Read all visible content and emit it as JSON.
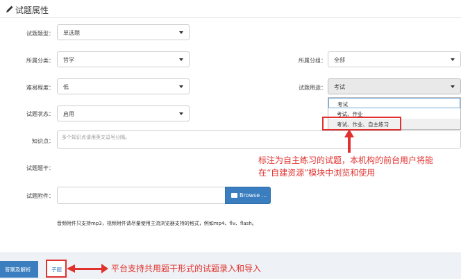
{
  "header": {
    "title": "试题属性",
    "icon": "pencil-icon"
  },
  "form": {
    "type_label": "试题题型：",
    "type_value": "单选题",
    "category_label": "所属分类：",
    "category_value": "哲学",
    "group_label": "所属分组：",
    "group_value": "全部",
    "difficulty_label": "难易程度：",
    "difficulty_value": "低",
    "usage_label": "试题用途：",
    "usage_value": "考试",
    "usage_options": [
      "考试",
      "考试、作业",
      "考试、作业、自主练习"
    ],
    "status_label": "试题状态：",
    "status_value": "启用",
    "knowledge_label": "知识点：",
    "knowledge_placeholder": "多个知识点请用英文逗号分隔。",
    "stem_label": "试题题干：",
    "attach_label": "试题附件：",
    "browse_label": "Browse ...",
    "attach_hint": "音频附件只支持mp3，视频附件请尽量使用主流浏览器支持的格式，例如mp4、flv、flash。"
  },
  "annotations": {
    "practice_note_line1": "标注为自主练习的试题，本机构的前台用户将能",
    "practice_note_line2": "在“自建资源”模块中浏览和使用",
    "stem_note": "平台支持共用题干形式的试题录入和导入"
  },
  "footer": {
    "answer_button": "答案及解析",
    "sub_button": "子题"
  },
  "colors": {
    "accent": "#3a7ebf",
    "annotation": "#e0312e"
  }
}
